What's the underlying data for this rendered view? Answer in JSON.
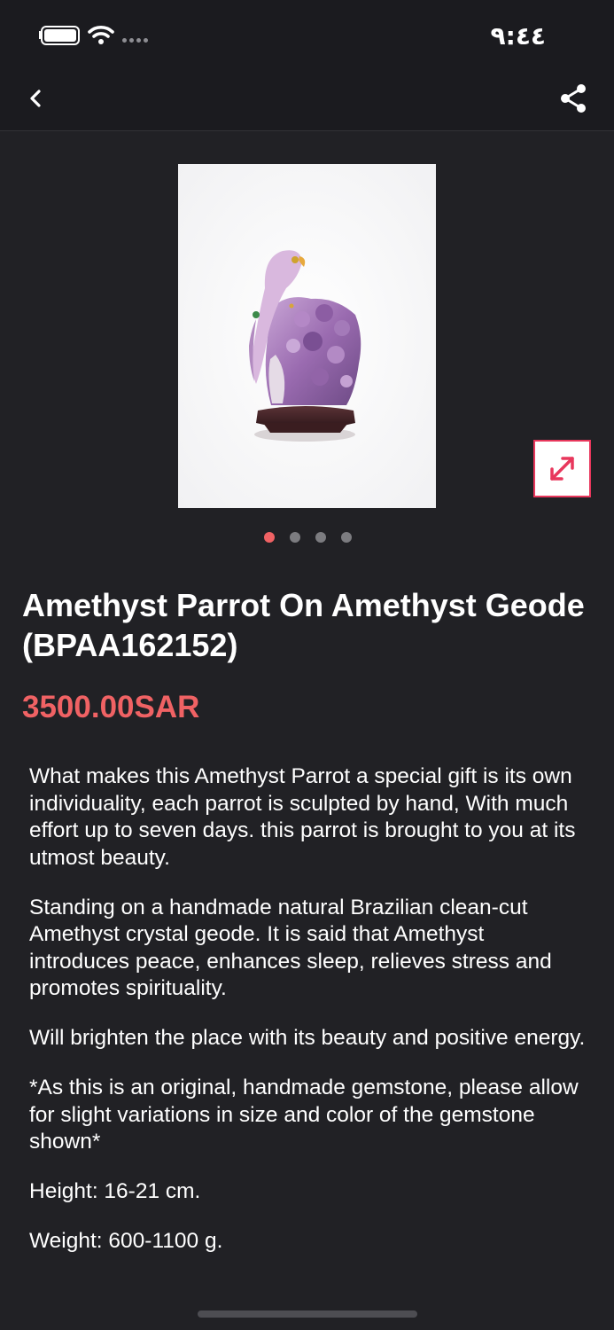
{
  "status_bar": {
    "time": "٩:٤٤",
    "battery": "battery-full-icon",
    "wifi": "wifi-icon",
    "signal": "signal-dots-icon"
  },
  "nav": {
    "back_icon": "chevron-left-icon",
    "share_icon": "share-icon"
  },
  "gallery": {
    "image_alt": "Amethyst Parrot On Amethyst Geode",
    "expand_icon": "expand-arrows-icon",
    "page_count": 4,
    "active_page": 1
  },
  "product": {
    "title": "Amethyst Parrot On Amethyst Geode (BPAA162152)",
    "price": "3500.00SAR",
    "description": [
      "What makes this Amethyst Parrot a special gift is its own individuality, each parrot is sculpted by hand, With much effort up to seven days. this parrot is brought to you at its utmost beauty.",
      "Standing on a handmade natural Brazilian clean-cut Amethyst crystal geode. It is said that Amethyst introduces peace, enhances sleep, relieves stress and promotes spirituality.",
      "Will brighten the place with its beauty and positive energy.",
      "*As this is an original, handmade gemstone, please allow for slight variations in size and color of the gemstone shown*",
      "Height: 16-21 cm.",
      "Weight: 600-1100 g."
    ]
  },
  "colors": {
    "background": "#212125",
    "bar": "#1b1b1f",
    "accent": "#f06264",
    "expand_border": "#e8375c"
  }
}
